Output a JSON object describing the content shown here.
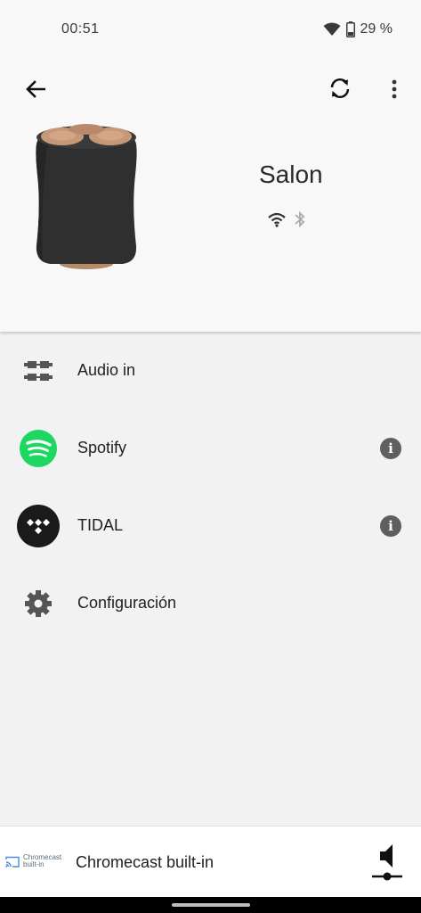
{
  "status": {
    "time": "00:51",
    "battery": "29 %",
    "icons": [
      "wifi-icon",
      "battery-icon"
    ]
  },
  "device": {
    "name": "Salon",
    "connection_icons": [
      "wifi-icon",
      "bluetooth-icon"
    ]
  },
  "header_actions": [
    "back-arrow-icon",
    "refresh-icon",
    "more-vert-icon"
  ],
  "menu": {
    "items": [
      {
        "label": "Audio in",
        "icon": "audio-cable-icon"
      },
      {
        "label": "Spotify",
        "icon": "spotify-icon",
        "info": true
      },
      {
        "label": "TIDAL",
        "icon": "tidal-icon",
        "info": true
      },
      {
        "label": "Configuración",
        "icon": "gear-icon"
      }
    ]
  },
  "bottom_bar": {
    "logo_line1": "Chromecast",
    "logo_line2": "built-in",
    "title": "Chromecast built-in",
    "volume_icon": "volume-icon"
  },
  "colors": {
    "spotify": "#1ed760",
    "tidal": "#1a1a1a",
    "speaker_body": "#2e2e2e",
    "speaker_top": "#c79877",
    "chromecast_blue": "#4a8fd8"
  }
}
